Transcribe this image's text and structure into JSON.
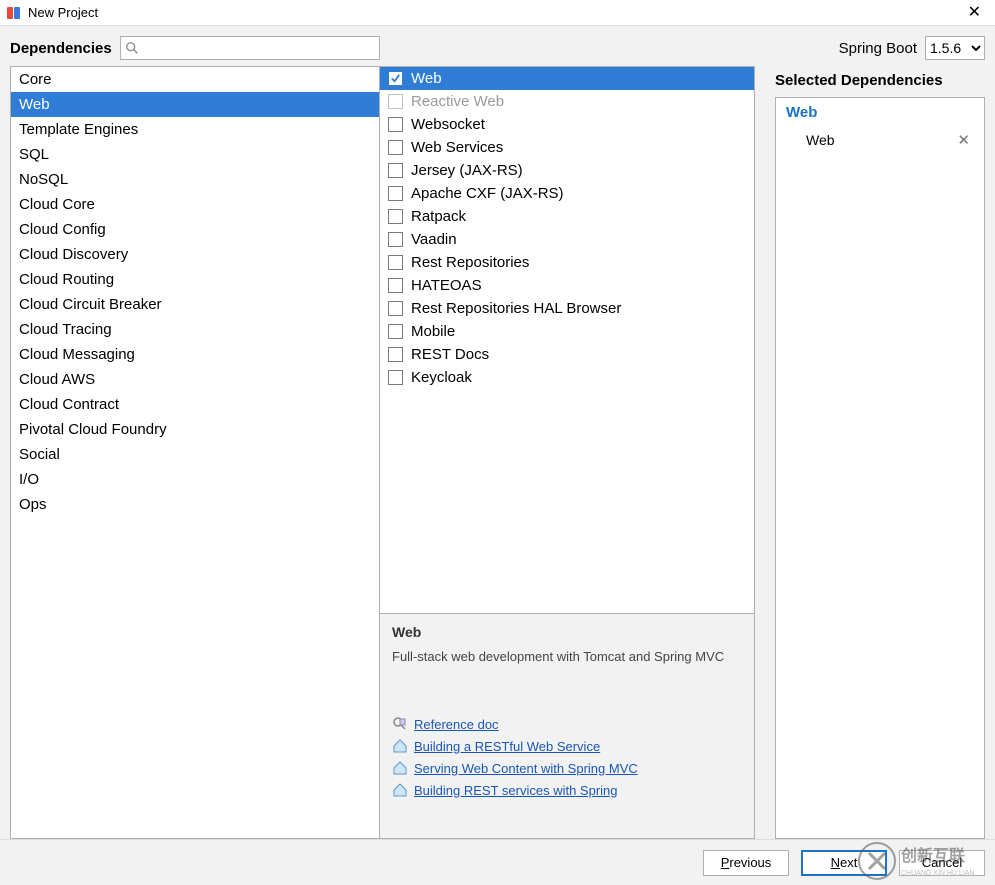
{
  "title": "New Project",
  "dependencies_label": "Dependencies",
  "search_placeholder": "",
  "spring_boot_label": "Spring Boot",
  "spring_version": "1.5.6",
  "selected_title": "Selected Dependencies",
  "categories": [
    "Core",
    "Web",
    "Template Engines",
    "SQL",
    "NoSQL",
    "Cloud Core",
    "Cloud Config",
    "Cloud Discovery",
    "Cloud Routing",
    "Cloud Circuit Breaker",
    "Cloud Tracing",
    "Cloud Messaging",
    "Cloud AWS",
    "Cloud Contract",
    "Pivotal Cloud Foundry",
    "Social",
    "I/O",
    "Ops"
  ],
  "selected_category_index": 1,
  "items": [
    {
      "name": "Web",
      "checked": true,
      "disabled": false
    },
    {
      "name": "Reactive Web",
      "checked": false,
      "disabled": true
    },
    {
      "name": "Websocket",
      "checked": false,
      "disabled": false
    },
    {
      "name": "Web Services",
      "checked": false,
      "disabled": false
    },
    {
      "name": "Jersey (JAX-RS)",
      "checked": false,
      "disabled": false
    },
    {
      "name": "Apache CXF (JAX-RS)",
      "checked": false,
      "disabled": false
    },
    {
      "name": "Ratpack",
      "checked": false,
      "disabled": false
    },
    {
      "name": "Vaadin",
      "checked": false,
      "disabled": false
    },
    {
      "name": "Rest Repositories",
      "checked": false,
      "disabled": false
    },
    {
      "name": "HATEOAS",
      "checked": false,
      "disabled": false
    },
    {
      "name": "Rest Repositories HAL Browser",
      "checked": false,
      "disabled": false
    },
    {
      "name": "Mobile",
      "checked": false,
      "disabled": false
    },
    {
      "name": "REST Docs",
      "checked": false,
      "disabled": false
    },
    {
      "name": "Keycloak",
      "checked": false,
      "disabled": false
    }
  ],
  "desc": {
    "title": "Web",
    "text": "Full-stack web development with Tomcat and Spring MVC",
    "links": [
      {
        "icon": "doc",
        "label": "Reference doc"
      },
      {
        "icon": "home",
        "label": "Building a RESTful Web Service"
      },
      {
        "icon": "home",
        "label": "Serving Web Content with Spring MVC"
      },
      {
        "icon": "home",
        "label": "Building REST services with Spring"
      }
    ]
  },
  "selected": {
    "group": "Web",
    "items": [
      "Web"
    ]
  },
  "buttons": {
    "previous": "Previous",
    "next": "Next",
    "cancel": "Cancel"
  },
  "watermark": {
    "brand": "创新互联",
    "sub": "CHUANG XIN LIAN"
  }
}
